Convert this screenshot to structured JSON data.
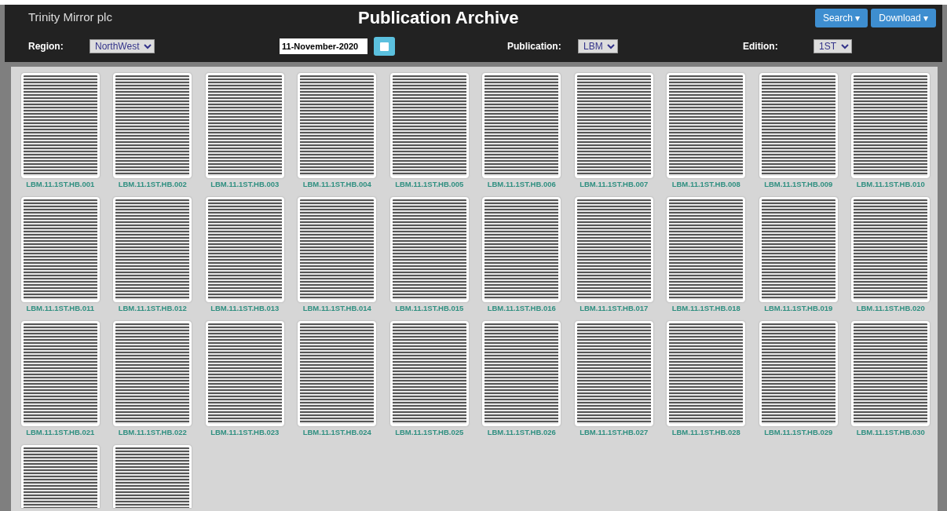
{
  "header": {
    "company": "Trinity Mirror plc",
    "title": "Publication Archive",
    "buttons": [
      {
        "label": "Search",
        "caret": "▾"
      },
      {
        "label": "Download",
        "caret": "▾"
      }
    ]
  },
  "filters": [
    {
      "kind": "select",
      "label": "Region:",
      "value": "NorthWest"
    },
    {
      "kind": "date",
      "value": "11-November-2020"
    },
    {
      "kind": "select",
      "label": "Publication:",
      "value": "LBM"
    },
    {
      "kind": "select",
      "label": "Edition:",
      "value": "1ST"
    }
  ],
  "pages": [
    {
      "label": "LBM.11.1ST.HB.001"
    },
    {
      "label": "LBM.11.1ST.HB.002"
    },
    {
      "label": "LBM.11.1ST.HB.003"
    },
    {
      "label": "LBM.11.1ST.HB.004"
    },
    {
      "label": "LBM.11.1ST.HB.005"
    },
    {
      "label": "LBM.11.1ST.HB.006"
    },
    {
      "label": "LBM.11.1ST.HB.007"
    },
    {
      "label": "LBM.11.1ST.HB.008"
    },
    {
      "label": "LBM.11.1ST.HB.009"
    },
    {
      "label": "LBM.11.1ST.HB.010"
    },
    {
      "label": "LBM.11.1ST.HB.011"
    },
    {
      "label": "LBM.11.1ST.HB.012"
    },
    {
      "label": "LBM.11.1ST.HB.013"
    },
    {
      "label": "LBM.11.1ST.HB.014"
    },
    {
      "label": "LBM.11.1ST.HB.015"
    },
    {
      "label": "LBM.11.1ST.HB.016"
    },
    {
      "label": "LBM.11.1ST.HB.017"
    },
    {
      "label": "LBM.11.1ST.HB.018"
    },
    {
      "label": "LBM.11.1ST.HB.019"
    },
    {
      "label": "LBM.11.1ST.HB.020"
    },
    {
      "label": "LBM.11.1ST.HB.021"
    },
    {
      "label": "LBM.11.1ST.HB.022"
    },
    {
      "label": "LBM.11.1ST.HB.023"
    },
    {
      "label": "LBM.11.1ST.HB.024"
    },
    {
      "label": "LBM.11.1ST.HB.025"
    },
    {
      "label": "LBM.11.1ST.HB.026"
    },
    {
      "label": "LBM.11.1ST.HB.027"
    },
    {
      "label": "LBM.11.1ST.HB.028"
    },
    {
      "label": "LBM.11.1ST.HB.029"
    },
    {
      "label": "LBM.11.1ST.HB.030"
    },
    {
      "kind": "cut"
    },
    {
      "kind": "cut"
    }
  ]
}
